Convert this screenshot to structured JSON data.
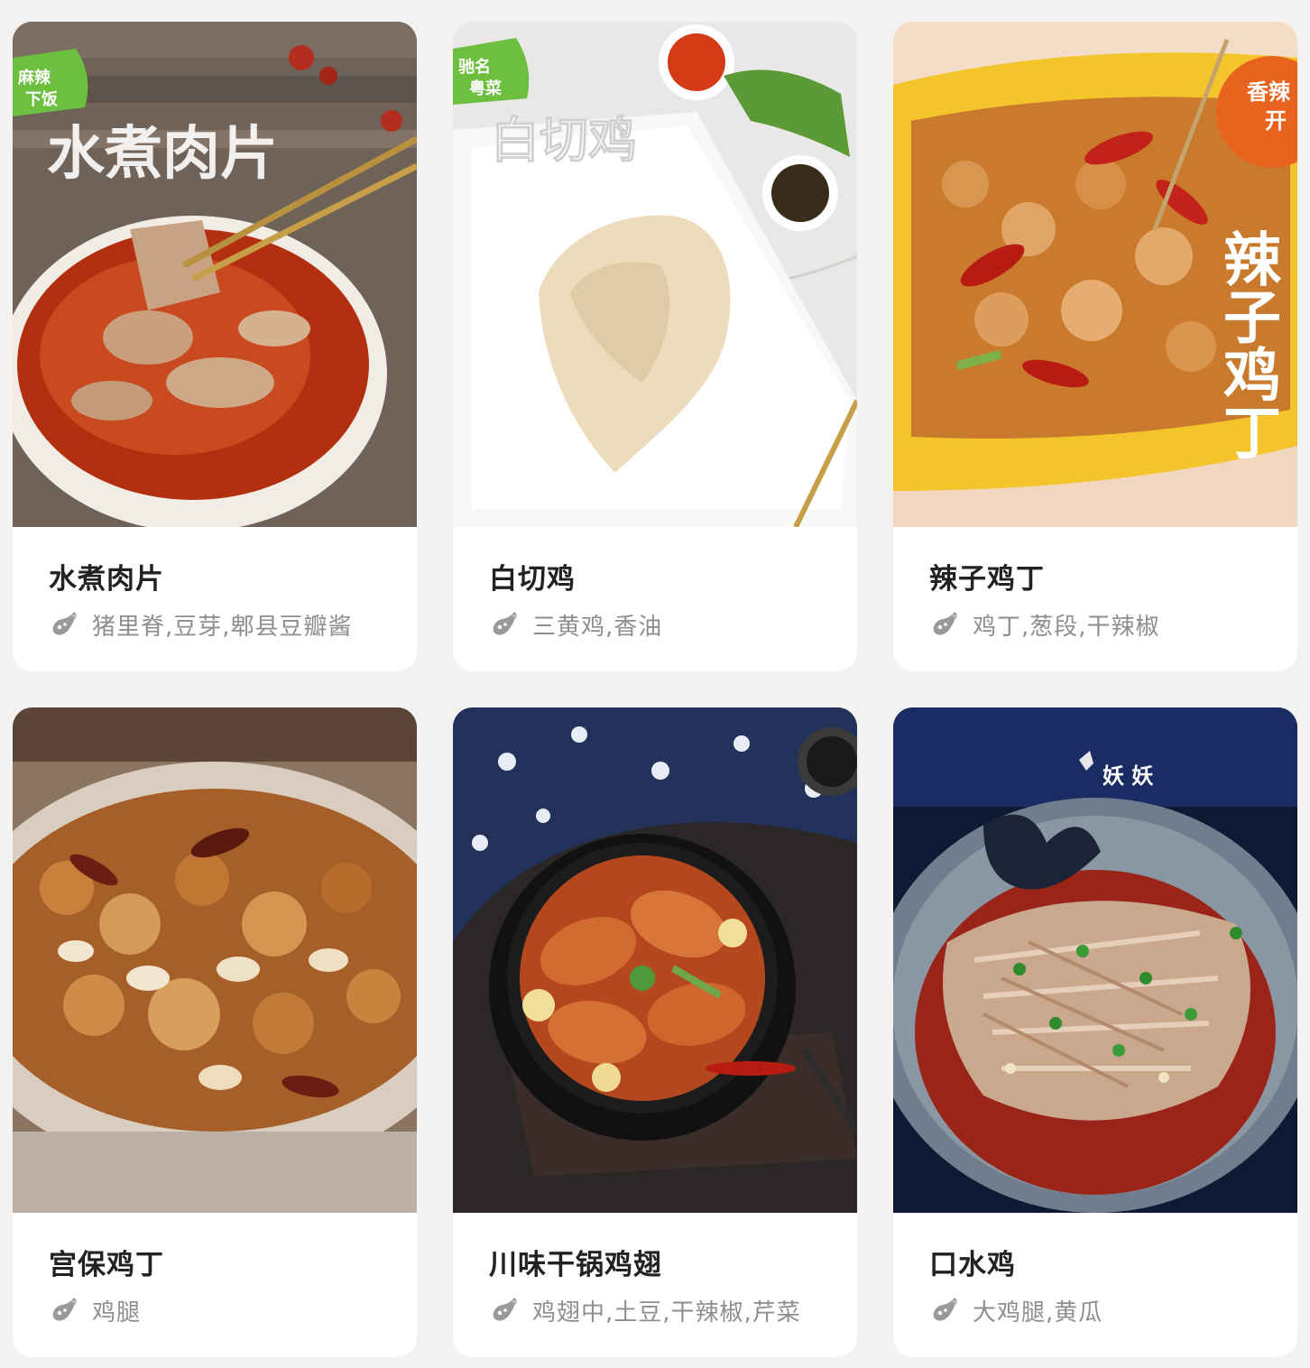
{
  "cards": [
    {
      "title": "水煮肉片",
      "ingredients": "猪里脊,豆芽,郫县豆瓣酱",
      "image": {
        "badge_lines": [
          "麻辣",
          "下饭"
        ],
        "overlay_text": "水煮肉片",
        "badge_color": "#6cbf3f"
      }
    },
    {
      "title": "白切鸡",
      "ingredients": "三黄鸡,香油",
      "image": {
        "badge_lines": [
          "驰名",
          "粤菜"
        ],
        "overlay_text": "白切鸡",
        "badge_color": "#6cbf3f"
      }
    },
    {
      "title": "辣子鸡丁",
      "ingredients": "鸡丁,葱段,干辣椒",
      "image": {
        "badge_lines": [
          "香辣",
          "开"
        ],
        "overlay_text": "辣子鸡丁",
        "badge_color": "#e8641e"
      }
    },
    {
      "title": "宫保鸡丁",
      "ingredients": "鸡腿",
      "image": {}
    },
    {
      "title": "川味干锅鸡翅",
      "ingredients": "鸡翅中,土豆,干辣椒,芹菜",
      "image": {}
    },
    {
      "title": "口水鸡",
      "ingredients": "大鸡腿,黄瓜",
      "image": {
        "watermark": "妖 妖"
      }
    }
  ],
  "icon_name": "eggplant-ingredients-icon",
  "colors": {
    "page_background": "#f4f2f0",
    "card_background": "#ffffff",
    "title_text": "#222222",
    "ingredient_text": "#8e8e8e",
    "icon_fill": "#9a9a9a"
  }
}
